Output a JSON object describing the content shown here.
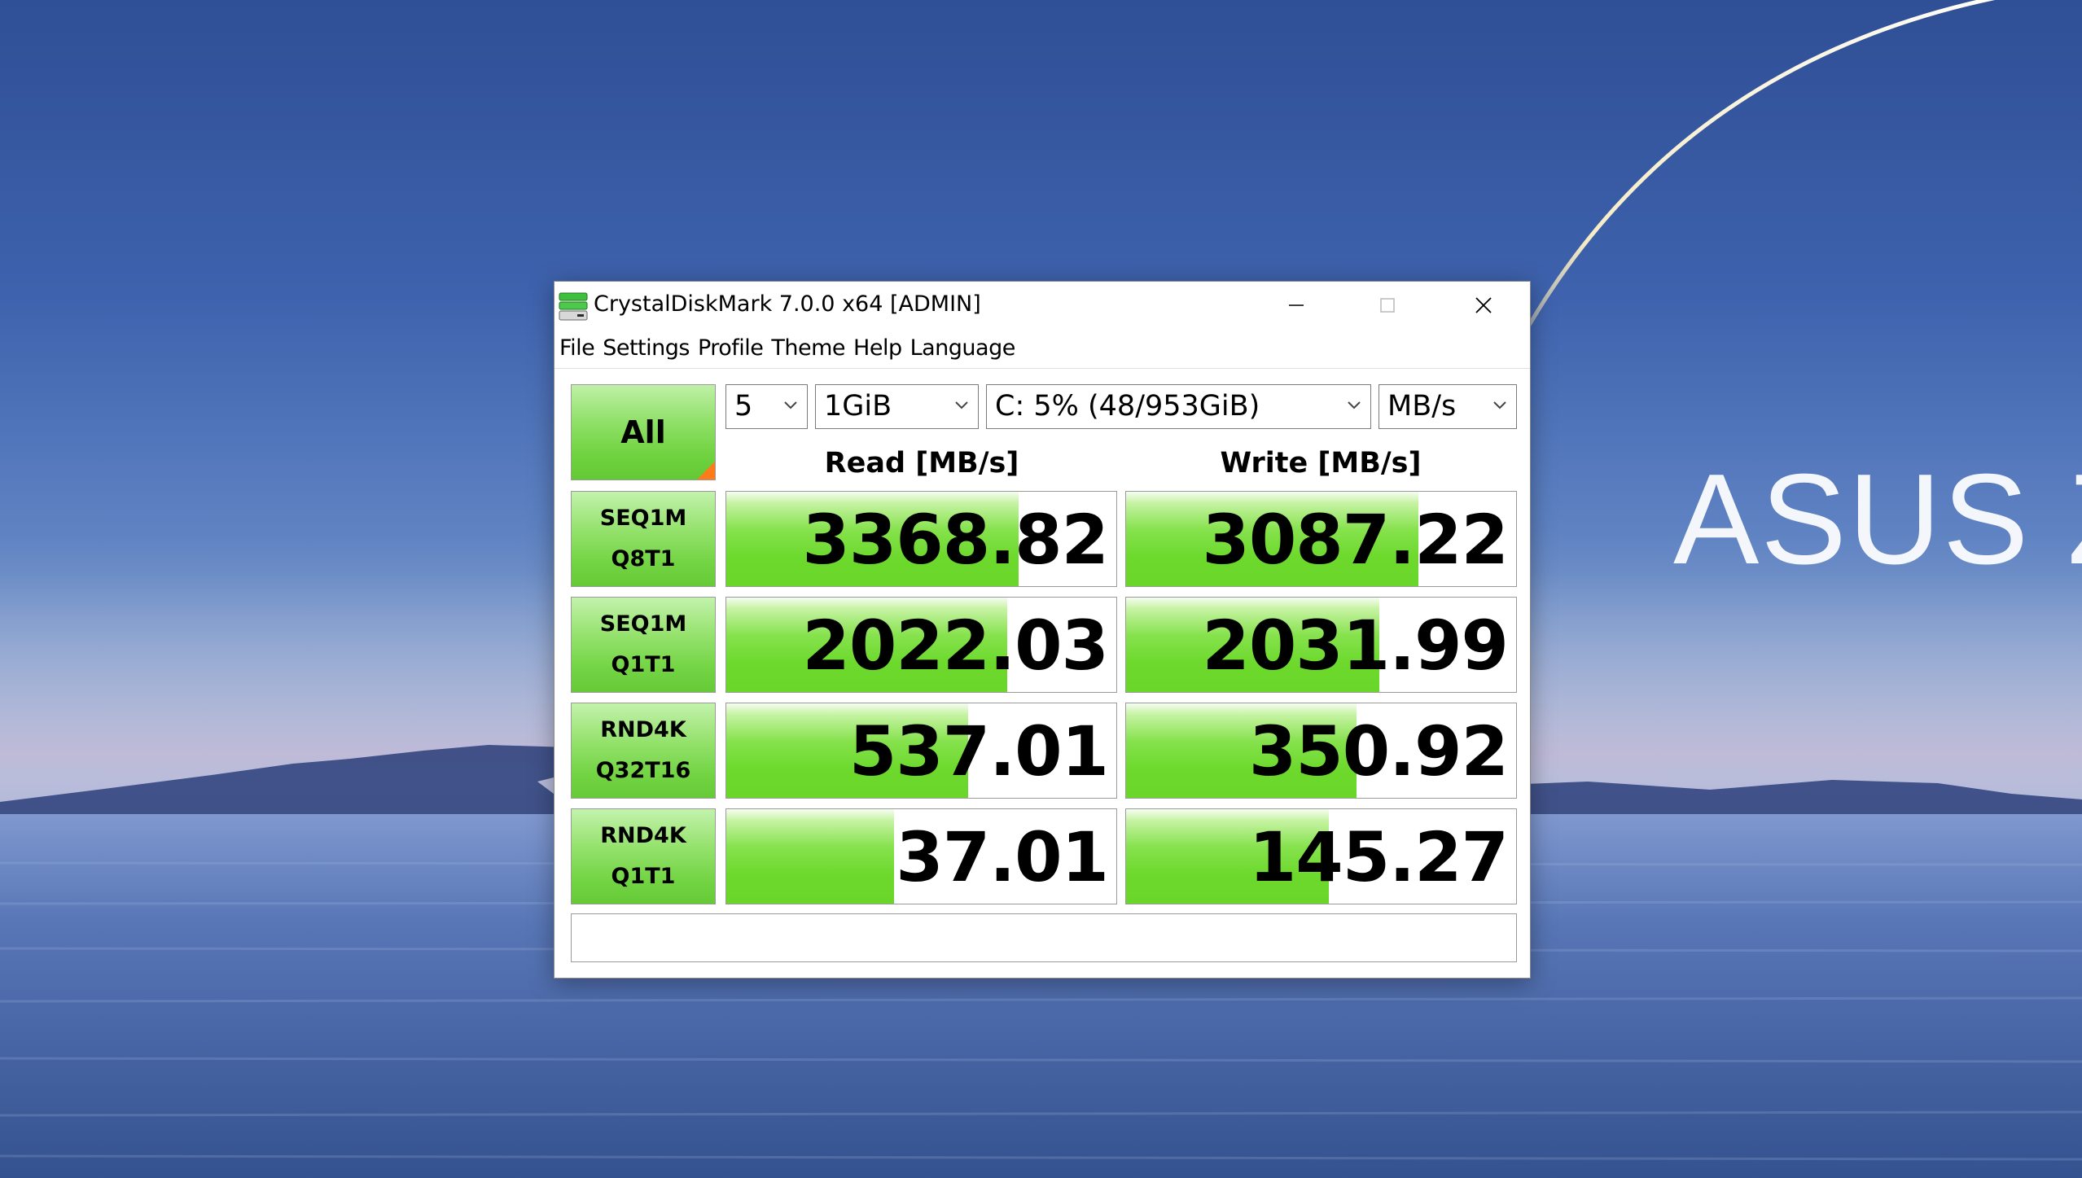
{
  "window": {
    "title": "CrystalDiskMark 7.0.0 x64 [ADMIN]"
  },
  "menu": [
    "File",
    "Settings",
    "Profile",
    "Theme",
    "Help",
    "Language"
  ],
  "controls": {
    "all_label": "All",
    "test_count": "5",
    "test_size": "1GiB",
    "drive": "C: 5% (48/953GiB)",
    "unit": "MB/s"
  },
  "headers": {
    "read": "Read [MB/s]",
    "write": "Write [MB/s]"
  },
  "tests": [
    {
      "name": "SEQ1M",
      "params": "Q8T1",
      "read": "3368.82",
      "write": "3087.22",
      "read_fill": 0.75,
      "write_fill": 0.75
    },
    {
      "name": "SEQ1M",
      "params": "Q1T1",
      "read": "2022.03",
      "write": "2031.99",
      "read_fill": 0.72,
      "write_fill": 0.65
    },
    {
      "name": "RND4K",
      "params": "Q32T16",
      "read": "537.01",
      "write": "350.92",
      "read_fill": 0.62,
      "write_fill": 0.59
    },
    {
      "name": "RND4K",
      "params": "Q1T1",
      "read": "37.01",
      "write": "145.27",
      "read_fill": 0.43,
      "write_fill": 0.52
    }
  ],
  "comment": "",
  "wallpaper": {
    "brand_text": "ASUS Ze"
  },
  "colors": {
    "bar_green": "#6ad62a",
    "label_green": "#73d444",
    "corner_orange": "#ff7a1a"
  }
}
